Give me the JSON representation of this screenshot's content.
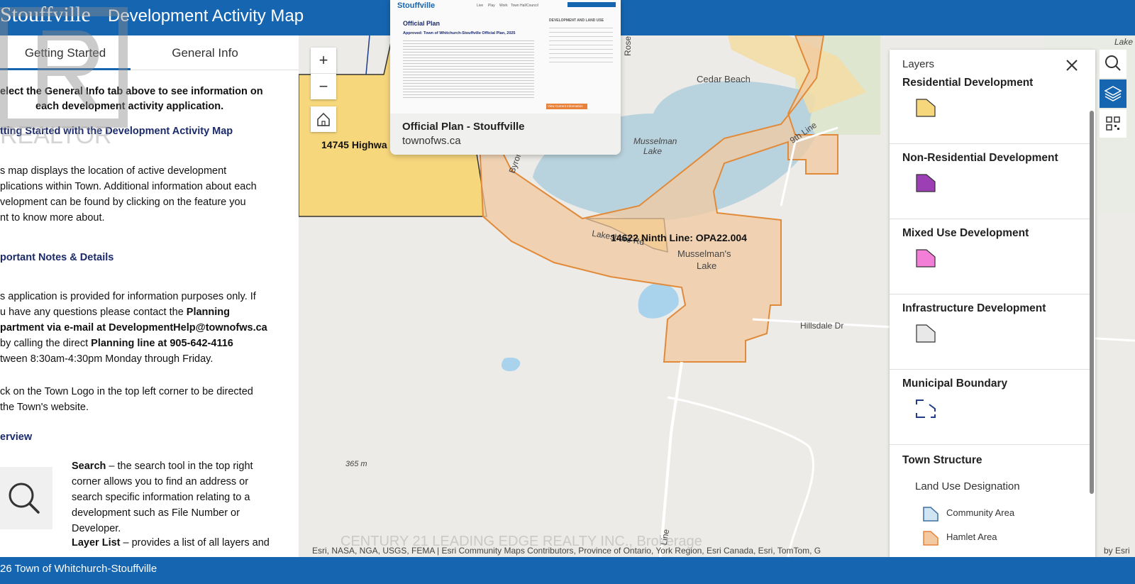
{
  "header": {
    "logo_text": "Stouffville",
    "title": "Development Activity Map"
  },
  "tabs": [
    {
      "label": "Getting Started",
      "active": true
    },
    {
      "label": "General Info",
      "active": false
    }
  ],
  "left_panel": {
    "intro_line1": "elect the General Info tab above to see information on",
    "intro_line2": "each development activity application.",
    "heading1": "tting Started with the Development Activity Map",
    "p1_line1": "s map displays the location of active development",
    "p1_line2": "plications within Town. Additional information about each",
    "p1_line3": "velopment can be found by clicking on the feature you",
    "p1_line4": "nt to know more about.",
    "heading2": "portant Notes & Details",
    "p2_line1": "s application is provided for information purposes only. If",
    "p2_line2a": "u have any questions please contact the ",
    "p2_line2b": "Planning",
    "p2_line3": "partment via e-mail at DevelopmentHelp@townofws.ca",
    "p2_line4a": "by calling the direct ",
    "p2_line4b": "Planning line at 905-642-4116",
    "p2_line5": "tween 8:30am-4:30pm Monday through Friday.",
    "p3_line1": "ck on the Town Logo in the top left corner to be directed",
    "p3_line2": "the Town's website.",
    "heading3": "erview",
    "search_title": "Search",
    "search_line1": " – the search tool in the top right",
    "search_line2": "corner allows you to find an address or",
    "search_line3": "search specific information relating to a",
    "search_line4": "development such as File Number or",
    "search_line5": "Developer.",
    "layer_title": "Layer List",
    "layer_line1": " – provides a list of all layers and"
  },
  "map": {
    "labels": {
      "highway": "14745 Highwa",
      "cedar_beach": "Cedar Beach",
      "musselman_lake": "Musselman",
      "musselman_lake2": "Lake",
      "ninth_line": "9th Line",
      "byron": "Byron St",
      "rose": "Rose",
      "lakeshore": "Lakeshore Rd",
      "opa": "14622 Ninth Line: OPA22.004",
      "musselmans": "Musselman's",
      "musselmans2": "Lake",
      "hillsdale": "Hillsdale Dr",
      "elevation": "365 m",
      "lake_corner": "Lake",
      "road_vert": "Line"
    },
    "zoom_in": "+",
    "zoom_out": "−"
  },
  "preview": {
    "title": "Official Plan - Stouffville",
    "url": "townofws.ca",
    "page_logo": "Stouffville",
    "page_heading": "Official Plan",
    "page_subheading": "Approved: Town of Whitchurch-Stouffville Official Plan, 2025",
    "page_nav": [
      "Live",
      "Play",
      "Work",
      "Town Hall",
      "Council"
    ],
    "page_side_heading": "DEVELOPMENT AND LAND USE",
    "page_button": "View Current Information"
  },
  "layers": {
    "header": "Layers",
    "groups": [
      {
        "title": "Residential Development",
        "color": "#f7d77c"
      },
      {
        "title": "Non-Residential Development",
        "color": "#9c3fb4"
      },
      {
        "title": "Mixed Use Development",
        "color": "#f37ed8"
      },
      {
        "title": "Infrastructure Development",
        "color": "#e8e8e8"
      },
      {
        "title": "Municipal Boundary",
        "color": "#1f3d8a"
      }
    ],
    "town_structure": "Town Structure",
    "land_use": "Land Use Designation",
    "items": [
      {
        "label": "Community Area",
        "color": "#cfe5f2"
      },
      {
        "label": "Hamlet Area",
        "color": "#e8823a"
      }
    ]
  },
  "footer": {
    "copyright": "26 Town of Whitchurch-Stouffville",
    "attribution": "Esri, NASA, NGA, USGS, FEMA | Esri Community Maps Contributors, Province of Ontario, York Region, Esri Canada, Esri, TomTom, G",
    "esri": "by Esri"
  },
  "watermark": {
    "brand": "REALTOR",
    "brokerage": "CENTURY 21 LEADING EDGE REALTY INC., Brokerage"
  }
}
